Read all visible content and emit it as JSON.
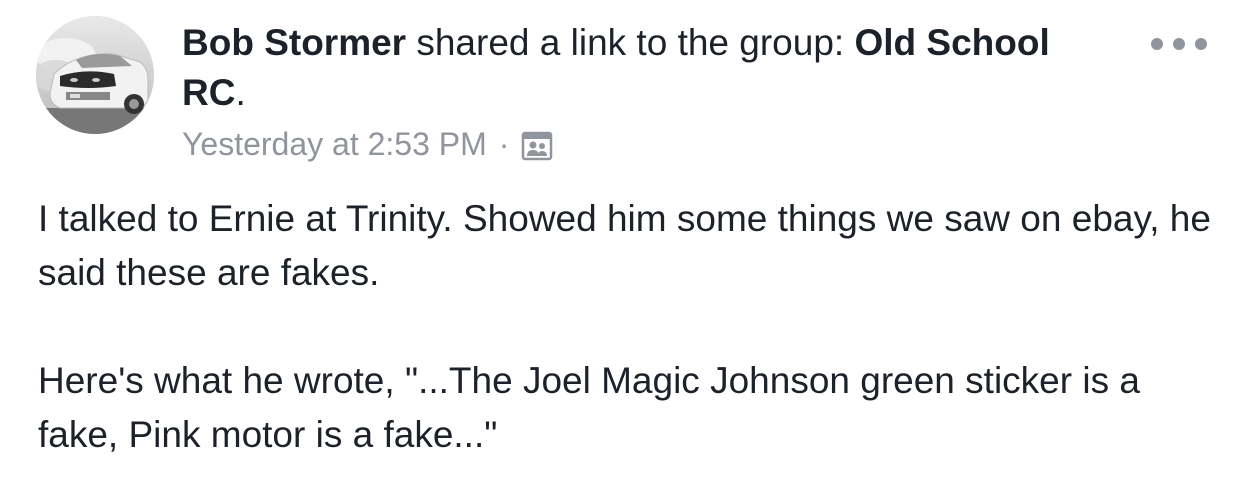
{
  "post": {
    "author": "Bob Stormer",
    "action_text": "shared a link to the group:",
    "group_name": "Old School RC",
    "trailing_period": ".",
    "timestamp": "Yesterday at 2:53 PM",
    "separator": "·",
    "audience_icon": "group-members-icon",
    "more_icon": "more-options-icon",
    "paragraphs": [
      "I talked to Ernie at Trinity.  Showed him some things we saw on ebay, he said these are fakes.",
      "Here's what he wrote, \"...The Joel Magic Johnson green sticker is a fake, Pink motor is a fake...\""
    ]
  },
  "colors": {
    "text": "#1d2129",
    "meta": "#90949c",
    "background": "#ffffff"
  }
}
